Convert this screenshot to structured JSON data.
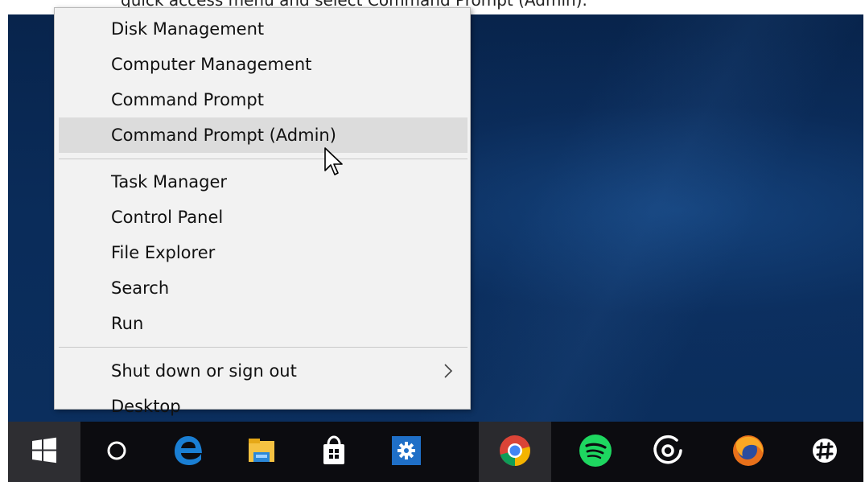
{
  "caption": "quick access menu and select Command Prompt (Admin).",
  "menu": {
    "group1": [
      {
        "label": "Disk Management"
      },
      {
        "label": "Computer Management"
      },
      {
        "label": "Command Prompt"
      },
      {
        "label": "Command Prompt (Admin)",
        "highlighted": true
      }
    ],
    "group2": [
      {
        "label": "Task Manager"
      },
      {
        "label": "Control Panel"
      },
      {
        "label": "File Explorer"
      },
      {
        "label": "Search"
      },
      {
        "label": "Run"
      }
    ],
    "group3": [
      {
        "label": "Shut down or sign out",
        "submenu_icon": "chevron-right-icon"
      },
      {
        "label": "Desktop"
      }
    ]
  },
  "taskbar": {
    "items": [
      {
        "icon": "windows-start-icon",
        "state": "active"
      },
      {
        "icon": "cortana-circle-icon"
      },
      {
        "icon": "edge-icon",
        "color": "#1a7fd4"
      },
      {
        "icon": "file-explorer-icon",
        "color": "#f5c242"
      },
      {
        "icon": "store-icon"
      },
      {
        "icon": "settings-gear-icon",
        "color": "#1f6fc7"
      },
      {
        "icon": "chrome-icon",
        "state": "open"
      },
      {
        "icon": "spotify-icon",
        "color": "#1ed760"
      },
      {
        "icon": "groove-music-icon"
      },
      {
        "icon": "firefox-icon",
        "color": "#e8701a"
      },
      {
        "icon": "slack-icon"
      }
    ]
  },
  "colors": {
    "desktop": "#0a2c5a",
    "taskbar": "#0c0c10",
    "menu_bg": "#f2f2f2",
    "menu_highlight": "#dcdcdc"
  }
}
